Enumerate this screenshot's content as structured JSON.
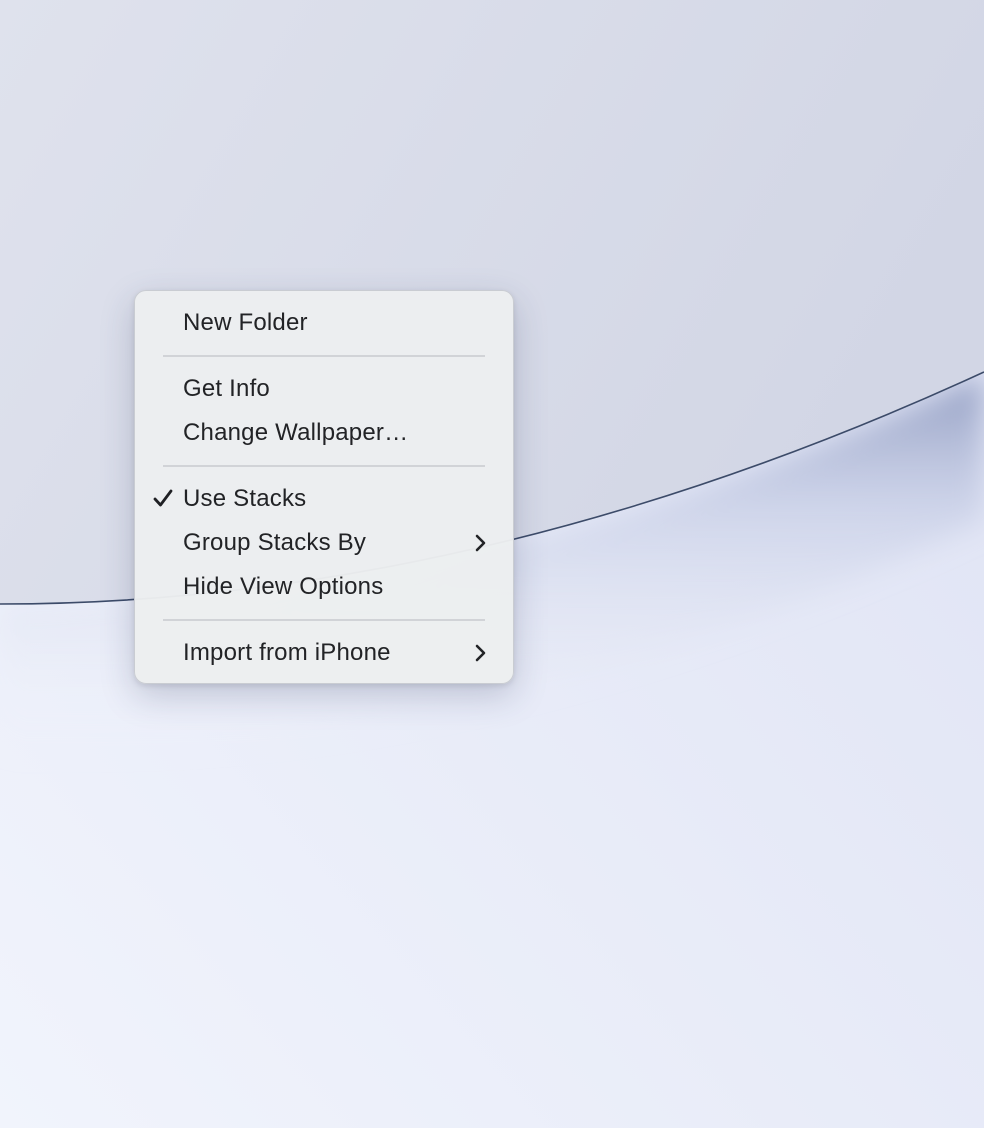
{
  "desktop": {
    "colors": {
      "sky_top": "#dfe2ed",
      "sky_right": "#d2d6e5",
      "lower_left": "#f1f4fc",
      "lower_right": "#dde1f3",
      "edge_line": "#3c4b69"
    }
  },
  "context_menu": {
    "groups": [
      [
        {
          "id": "new-folder",
          "label": "New Folder",
          "checked": false,
          "submenu": false
        }
      ],
      [
        {
          "id": "get-info",
          "label": "Get Info",
          "checked": false,
          "submenu": false
        },
        {
          "id": "change-wallpaper",
          "label": "Change Wallpaper…",
          "checked": false,
          "submenu": false
        }
      ],
      [
        {
          "id": "use-stacks",
          "label": "Use Stacks",
          "checked": true,
          "submenu": false
        },
        {
          "id": "group-stacks-by",
          "label": "Group Stacks By",
          "checked": false,
          "submenu": true
        },
        {
          "id": "hide-view-options",
          "label": "Hide View Options",
          "checked": false,
          "submenu": false
        }
      ],
      [
        {
          "id": "import-from-iphone",
          "label": "Import from iPhone",
          "checked": false,
          "submenu": true
        }
      ]
    ],
    "icons": {
      "check": "checkmark-icon",
      "submenu": "chevron-right-icon"
    }
  }
}
